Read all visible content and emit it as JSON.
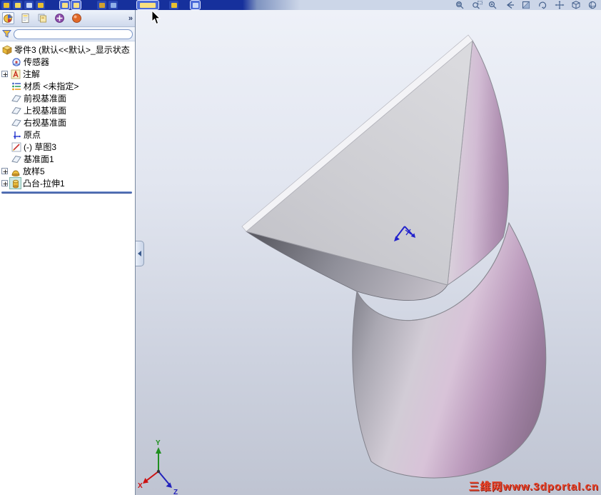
{
  "colors": {
    "titlebar_blue": "#16309c",
    "selection_teal": "#cfe9e4",
    "watermark_red": "#e8442a",
    "viewport_top": "#eef1f8",
    "viewport_bottom": "#bfc4d2",
    "cylinder_pink": "#d8c3d8"
  },
  "top_toolbar": {
    "view_icons": [
      "zoom-to-fit",
      "zoom-to-area",
      "zoom-in-out",
      "previous-view",
      "section-view",
      "rotate-view",
      "pan",
      "view-orientation",
      "display-style"
    ]
  },
  "panel": {
    "overflow_chevron": "»",
    "tabs": [
      "featuremanager",
      "propertymanager",
      "configurationmanager",
      "dimxpertmanager",
      "displaymanager"
    ],
    "filter": {
      "value": "",
      "placeholder": ""
    },
    "tree": {
      "items": [
        {
          "label": "零件3  (默认<<默认>_显示状态",
          "icon": "part"
        },
        {
          "label": "传感器",
          "icon": "sensors"
        },
        {
          "label": "注解",
          "icon": "annotations",
          "expandable": true
        },
        {
          "label": "材质 <未指定>",
          "icon": "material"
        },
        {
          "label": "前视基准面",
          "icon": "plane"
        },
        {
          "label": "上视基准面",
          "icon": "plane"
        },
        {
          "label": "右视基准面",
          "icon": "plane"
        },
        {
          "label": "原点",
          "icon": "origin"
        },
        {
          "label": "(-) 草图3",
          "icon": "sketch"
        },
        {
          "label": "基准面1",
          "icon": "plane"
        },
        {
          "label": "放样5",
          "icon": "loft",
          "expandable": true
        },
        {
          "label": "凸台-拉伸1",
          "icon": "extrude",
          "expandable": true
        }
      ]
    }
  },
  "viewport": {
    "watermark": "三维网www.3dportal.cn",
    "triad": {
      "x_label": "X",
      "y_label": "Y",
      "z_label": "Z"
    }
  }
}
